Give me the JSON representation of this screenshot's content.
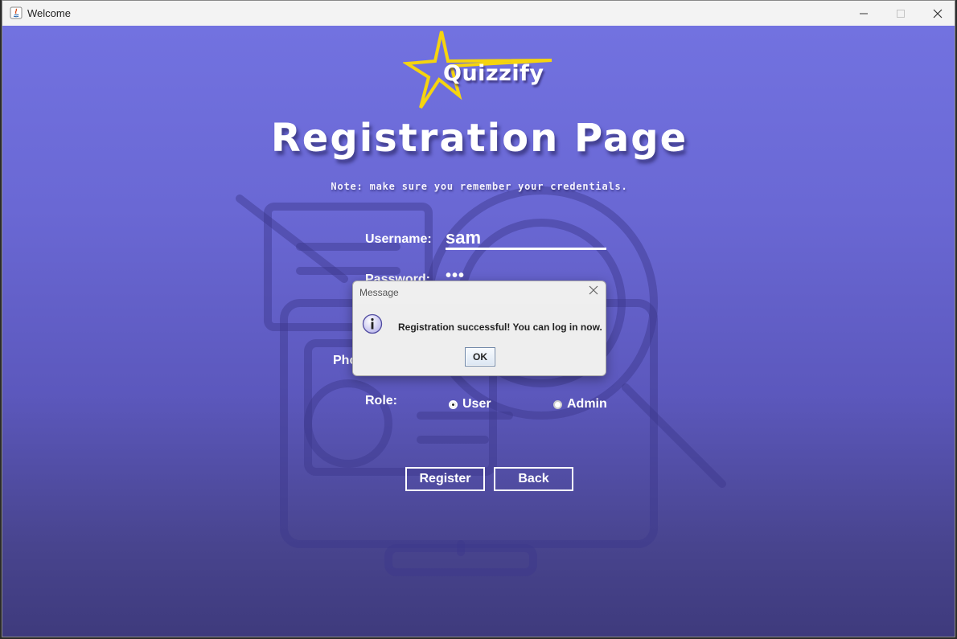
{
  "window": {
    "title": "Welcome"
  },
  "app": {
    "logo_text": "Quizzify",
    "page_title": "Registration Page",
    "note": "Note: make sure you remember your credentials."
  },
  "form": {
    "username_label": "Username:",
    "username_value": "sam",
    "password_label": "Password:",
    "password_value": "•••",
    "phone_label_partial": "Pho",
    "role_label": "Role:",
    "role_options": [
      {
        "label": "User",
        "selected": true
      },
      {
        "label": "Admin",
        "selected": false
      }
    ]
  },
  "buttons": {
    "register": "Register",
    "back": "Back"
  },
  "dialog": {
    "title": "Message",
    "message": "Registration successful! You can log in now.",
    "ok": "OK",
    "icon": "info-icon"
  },
  "colors": {
    "bg_top": "#7272e0",
    "bg_bottom": "#3e3a7c",
    "star": "#f5d40f"
  }
}
